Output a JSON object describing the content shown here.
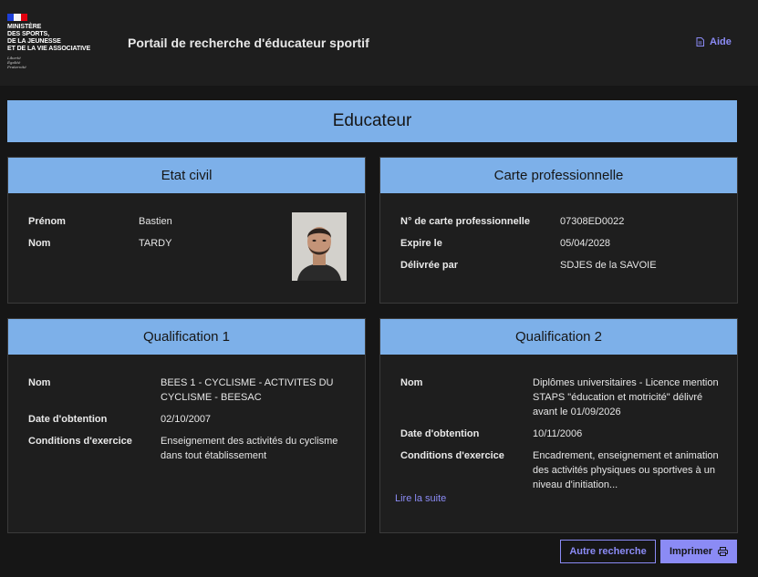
{
  "header": {
    "ministry_lines": "MINISTÈRE\nDES SPORTS,\nDE LA JEUNESSE\nET DE LA VIE ASSOCIATIVE",
    "motto": "Liberté\nÉgalité\nFraternité",
    "portal_title": "Portail de recherche d'éducateur sportif",
    "help_label": "Aide",
    "flag_colors": [
      "#1d3fd8",
      "#f4f4f4",
      "#e1000f"
    ]
  },
  "page_title": "Educateur",
  "etat_civil": {
    "title": "Etat civil",
    "rows": [
      {
        "label": "Prénom",
        "value": "Bastien"
      },
      {
        "label": "Nom",
        "value": "TARDY"
      }
    ]
  },
  "carte_pro": {
    "title": "Carte professionnelle",
    "rows": [
      {
        "label": "N° de carte professionnelle",
        "value": "07308ED0022"
      },
      {
        "label": "Expire le",
        "value": "05/04/2028"
      },
      {
        "label": "Délivrée par",
        "value": "SDJES de la SAVOIE"
      }
    ]
  },
  "qualification1": {
    "title": "Qualification 1",
    "rows": [
      {
        "label": "Nom",
        "value": "BEES 1 - CYCLISME - ACTIVITES DU CYCLISME - BEESAC"
      },
      {
        "label": "Date d'obtention",
        "value": "02/10/2007"
      },
      {
        "label": "Conditions d'exercice",
        "value": "Enseignement des activités du cyclisme dans tout établissement"
      }
    ]
  },
  "qualification2": {
    "title": "Qualification 2",
    "rows": [
      {
        "label": "Nom",
        "value": "Diplômes universitaires - Licence mention STAPS \"éducation et motricité\" délivré avant le 01/09/2026"
      },
      {
        "label": "Date d'obtention",
        "value": "10/11/2006"
      },
      {
        "label": "Conditions d'exercice",
        "value": "Encadrement, enseignement et animation des activités physiques ou sportives à un niveau d'initiation..."
      }
    ],
    "read_more": "Lire la suite"
  },
  "actions": {
    "new_search": "Autre recherche",
    "print": "Imprimer"
  },
  "colors": {
    "background": "#161616",
    "panel": "#1e1e1e",
    "banner": "#7db0e9",
    "accent": "#8b8bf5"
  }
}
